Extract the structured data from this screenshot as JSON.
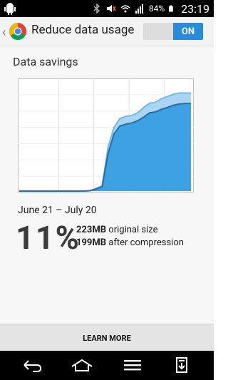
{
  "status_bar": {
    "battery_percent": "84%",
    "time": "23:19",
    "icons": [
      "android-icon",
      "bluetooth-icon",
      "mute-icon",
      "wifi-icon",
      "signal-icon",
      "battery-icon"
    ]
  },
  "app_bar": {
    "title": "Reduce data usage",
    "toggle_label": "ON",
    "accent_color": "#2a8bd8"
  },
  "main": {
    "section_title": "Data savings",
    "date_range": "June 21 – July 20",
    "savings_percent": "11%",
    "original": {
      "amount": "223MB",
      "suffix": " original size"
    },
    "compressed": {
      "amount": "199MB",
      "suffix": " after compression"
    }
  },
  "chart_data": {
    "type": "area",
    "title": "",
    "xlabel": "",
    "ylabel": "",
    "x": [
      0,
      1,
      2,
      3,
      4,
      5,
      6,
      7,
      8,
      9,
      10,
      11,
      12,
      13,
      14,
      15,
      16,
      17,
      18,
      19,
      20,
      21,
      22,
      23,
      24,
      25,
      26,
      27,
      28,
      29
    ],
    "xlim": [
      0,
      29
    ],
    "ylim": [
      0,
      240
    ],
    "grid": true,
    "series": [
      {
        "name": "",
        "color": "#a9d5f2",
        "values": [
          0,
          0,
          0,
          0,
          0,
          0,
          0,
          0,
          0,
          0,
          0,
          0,
          1,
          6,
          12,
          100,
          145,
          165,
          170,
          172,
          178,
          190,
          200,
          202,
          210,
          215,
          220,
          223,
          223,
          223
        ]
      },
      {
        "name": "",
        "color": "#3ea1e2",
        "values": [
          0,
          0,
          0,
          0,
          0,
          0,
          0,
          0,
          0,
          0,
          0,
          0,
          1,
          5,
          10,
          85,
          130,
          148,
          152,
          155,
          160,
          168,
          178,
          180,
          186,
          190,
          195,
          198,
          199,
          199
        ]
      }
    ]
  },
  "learn_more": {
    "label": "LEARN MORE"
  },
  "nav_bar": {
    "buttons": [
      "back-icon",
      "home-icon",
      "menu-icon",
      "notes-icon"
    ]
  }
}
